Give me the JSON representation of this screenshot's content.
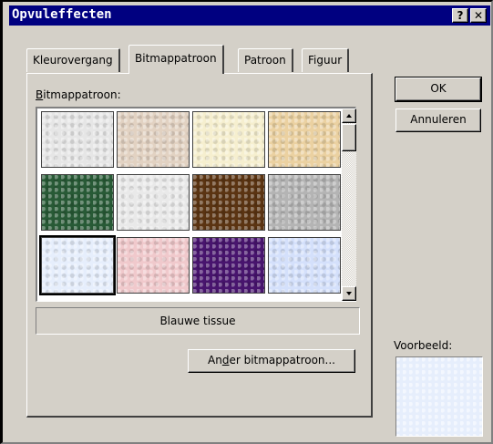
{
  "window": {
    "title": "Opvuleffecten",
    "help_label": "?",
    "close_label": "✕"
  },
  "tabs": [
    {
      "label": "Kleurovergang",
      "active": false
    },
    {
      "label": "Bitmappatroon",
      "active": true
    },
    {
      "label": "Patroon",
      "active": false
    },
    {
      "label": "Figuur",
      "active": false
    }
  ],
  "bitmap_group": {
    "label_first": "B",
    "label_rest": "itmappatroon:",
    "selected_name": "Blauwe tissue",
    "tiles": [
      {
        "icon": "white-marble-texture",
        "color": "#e6e6e6",
        "selected": false
      },
      {
        "icon": "beige-parchment-texture",
        "color": "#e2d2c2",
        "selected": false
      },
      {
        "icon": "cream-paper-texture",
        "color": "#f6efcf",
        "selected": false
      },
      {
        "icon": "tan-sand-texture",
        "color": "#ebd1a1",
        "selected": false
      },
      {
        "icon": "green-marble-texture",
        "color": "#285a36",
        "selected": false
      },
      {
        "icon": "white-grey-marble-texture",
        "color": "#e9e9e9",
        "selected": false
      },
      {
        "icon": "brown-marble-texture",
        "color": "#5b3412",
        "selected": false
      },
      {
        "icon": "granite-texture",
        "color": "#b4b4b4",
        "selected": false
      },
      {
        "icon": "blue-tissue-texture",
        "color": "#e6eefc",
        "selected": true
      },
      {
        "icon": "pink-tissue-texture",
        "color": "#f0c9cc",
        "selected": false
      },
      {
        "icon": "purple-mesh-texture",
        "color": "#48146e",
        "selected": false
      },
      {
        "icon": "blue-pink-tissue-texture",
        "color": "#d4e0fb",
        "selected": false
      }
    ]
  },
  "buttons": {
    "other_bitmap_pre": "An",
    "other_bitmap_ul": "d",
    "other_bitmap_post": "er bitmappatroon...",
    "ok": "OK",
    "cancel": "Annuleren"
  },
  "preview": {
    "label": "Voorbeeld:",
    "color": "#e6eefc"
  }
}
